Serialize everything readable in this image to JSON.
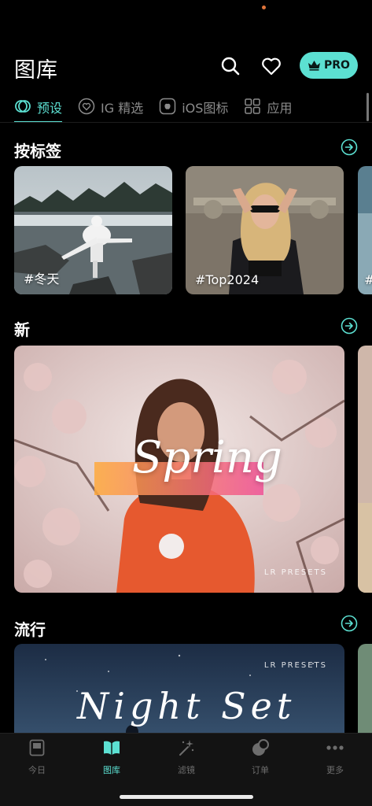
{
  "header": {
    "title": "图库",
    "pro_label": "PRO"
  },
  "tabs": [
    {
      "label": "预设",
      "icon": "preset-icon",
      "active": true
    },
    {
      "label": "IG 精选",
      "icon": "ig-heart-icon",
      "active": false
    },
    {
      "label": "iOS图标",
      "icon": "apple-icon",
      "active": false
    },
    {
      "label": "应用",
      "icon": "grid-icon",
      "active": false
    }
  ],
  "sections": {
    "tags": {
      "title": "按标签",
      "cards": [
        {
          "tag": "#冬天"
        },
        {
          "tag": "#Top2024"
        },
        {
          "tag": "#"
        }
      ]
    },
    "new": {
      "title": "新",
      "feature": {
        "word": "Spring",
        "badge": "LR PRESETS"
      }
    },
    "popular": {
      "title": "流行",
      "feature": {
        "word": "Night Set",
        "badge": "LR PRESETS"
      }
    }
  },
  "bottom_nav": [
    {
      "label": "今日",
      "icon": "today-icon",
      "active": false
    },
    {
      "label": "图库",
      "icon": "library-icon",
      "active": true
    },
    {
      "label": "滤镜",
      "icon": "sparkle-icon",
      "active": false
    },
    {
      "label": "订单",
      "icon": "order-icon",
      "active": false
    },
    {
      "label": "更多",
      "icon": "more-icon",
      "active": false
    }
  ],
  "colors": {
    "accent": "#5ce0d2",
    "background": "#000000",
    "nav_bg": "#131313"
  }
}
